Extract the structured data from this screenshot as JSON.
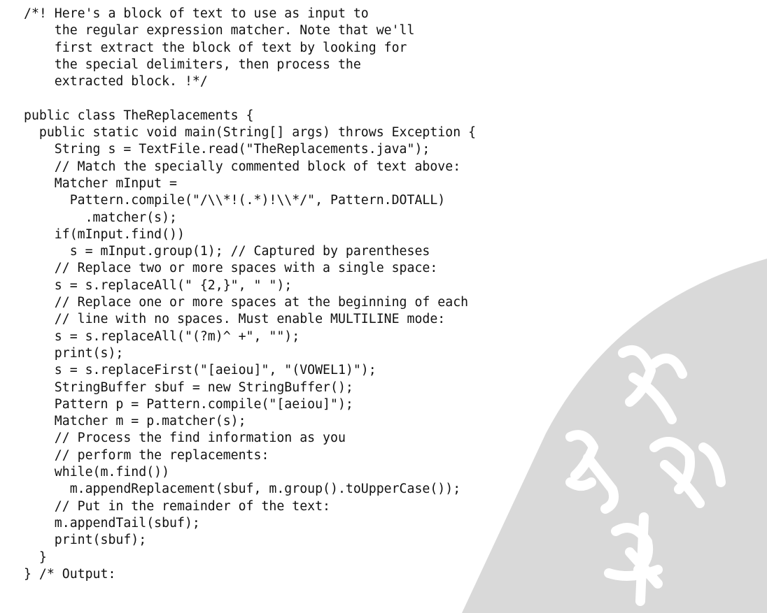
{
  "code": {
    "lines": [
      "/*! Here's a block of text to use as input to",
      "    the regular expression matcher. Note that we'll",
      "    first extract the block of text by looking for",
      "    the special delimiters, then process the",
      "    extracted block. !*/",
      "",
      "public class TheReplacements {",
      "  public static void main(String[] args) throws Exception {",
      "    String s = TextFile.read(\"TheReplacements.java\");",
      "    // Match the specially commented block of text above:",
      "    Matcher mInput =",
      "      Pattern.compile(\"/\\\\*!(.*)!\\\\*/\", Pattern.DOTALL)",
      "        .matcher(s);",
      "    if(mInput.find())",
      "      s = mInput.group(1); // Captured by parentheses",
      "    // Replace two or more spaces with a single space:",
      "    s = s.replaceAll(\" {2,}\", \" \");",
      "    // Replace one or more spaces at the beginning of each",
      "    // line with no spaces. Must enable MULTILINE mode:",
      "    s = s.replaceAll(\"(?m)^ +\", \"\");",
      "    print(s);",
      "    s = s.replaceFirst(\"[aeiou]\", \"(VOWEL1)\");",
      "    StringBuffer sbuf = new StringBuffer();",
      "    Pattern p = Pattern.compile(\"[aeiou]\");",
      "    Matcher m = p.matcher(s);",
      "    // Process the find information as you",
      "    // perform the replacements:",
      "    while(m.find())",
      "      m.appendReplacement(sbuf, m.group().toUpperCase());",
      "    // Put in the remainder of the text:",
      "    m.appendTail(sbuf);",
      "    print(sbuf);",
      "  }",
      "} /* Output:"
    ]
  },
  "colors": {
    "text": "#111111",
    "watermark_fill": "#d9d9d9",
    "watermark_stroke": "#ffffff"
  }
}
